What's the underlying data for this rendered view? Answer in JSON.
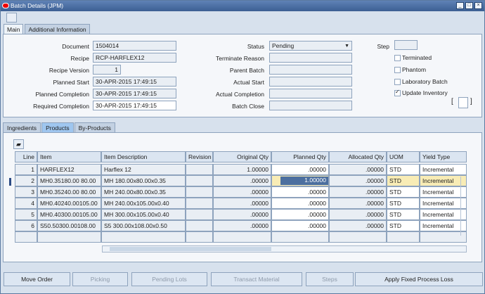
{
  "window": {
    "title": "Batch Details (JPM)"
  },
  "tabs": [
    {
      "label": "Main"
    },
    {
      "label": "Additional Information"
    }
  ],
  "header": {
    "document_label": "Document",
    "document_value": "1504014",
    "recipe_label": "Recipe",
    "recipe_value": "RCP-HARFLEX12",
    "recipe_version_label": "Recipe Version",
    "recipe_version_value": "1",
    "planned_start_label": "Planned Start",
    "planned_start_value": "30-APR-2015 17:49:15",
    "planned_completion_label": "Planned Completion",
    "planned_completion_value": "30-APR-2015 17:49:15",
    "required_completion_label": "Required Completion",
    "required_completion_value": "30-APR-2015 17:49:15",
    "status_label": "Status",
    "status_value": "Pending",
    "terminate_reason_label": "Terminate Reason",
    "parent_batch_label": "Parent Batch",
    "actual_start_label": "Actual Start",
    "actual_completion_label": "Actual Completion",
    "batch_close_label": "Batch Close",
    "step_label": "Step",
    "terminated_label": "Terminated",
    "phantom_label": "Phantom",
    "laboratory_batch_label": "Laboratory Batch",
    "update_inventory_label": "Update Inventory"
  },
  "subtabs": [
    {
      "label": "Ingredients"
    },
    {
      "label": "Products"
    },
    {
      "label": "By-Products"
    }
  ],
  "columns": [
    "Line",
    "Item",
    "Item Description",
    "Revision",
    "Original Qty",
    "Planned Qty",
    "Allocated Qty",
    "UOM",
    "Yield Type"
  ],
  "rows": [
    {
      "line": "1",
      "item": "HARFLEX12",
      "description": "Harflex 12",
      "revision": "",
      "original_qty": "1.00000",
      "planned_qty": ".00000",
      "allocated_qty": ".00000",
      "uom": "STD",
      "yield_type": "Incremental"
    },
    {
      "line": "2",
      "item": "MH0.35180.00 80.00",
      "description": "MH 180.00x80.00x0.35",
      "revision": "",
      "original_qty": ".00000",
      "planned_qty": "1.00000",
      "allocated_qty": ".00000",
      "uom": "STD",
      "yield_type": "Incremental"
    },
    {
      "line": "3",
      "item": "MH0.35240.00 80.00",
      "description": "MH 240.00x80.00x0.35",
      "revision": "",
      "original_qty": ".00000",
      "planned_qty": ".00000",
      "allocated_qty": ".00000",
      "uom": "STD",
      "yield_type": "Incremental"
    },
    {
      "line": "4",
      "item": "MH0.40240.00105.00",
      "description": "MH 240.00x105.00x0.40",
      "revision": "",
      "original_qty": ".00000",
      "planned_qty": ".00000",
      "allocated_qty": ".00000",
      "uom": "STD",
      "yield_type": "Incremental"
    },
    {
      "line": "5",
      "item": "MH0.40300.00105.00",
      "description": "MH 300.00x105.00x0.40",
      "revision": "",
      "original_qty": ".00000",
      "planned_qty": ".00000",
      "allocated_qty": ".00000",
      "uom": "STD",
      "yield_type": "Incremental"
    },
    {
      "line": "6",
      "item": "S50.50300.00108.00",
      "description": "S5 300.00x108.00x0.50",
      "revision": "",
      "original_qty": ".00000",
      "planned_qty": ".00000",
      "allocated_qty": ".00000",
      "uom": "STD",
      "yield_type": "Incremental"
    }
  ],
  "buttons": [
    "Move Order",
    "Picking",
    "Pending Lots",
    "Transact Material",
    "Steps",
    "Apply Fixed Process Loss"
  ],
  "icons": {
    "window_close": "close-icon",
    "minimize": "minimize-icon",
    "restore": "restore-icon",
    "toolbar": "document-icon",
    "folder": "folder-icon"
  },
  "colors": {
    "accent": "#4c6f9f",
    "selected_tab": "#9fc6ef",
    "yellow_highlight": "#f8ecb5"
  }
}
